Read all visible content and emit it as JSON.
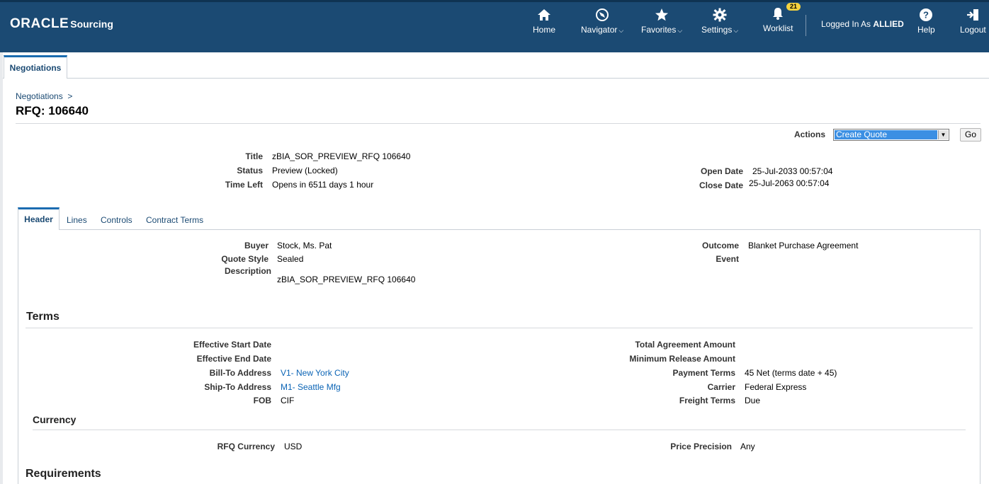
{
  "header": {
    "logo": "ORACLE",
    "product": "Sourcing",
    "nav": {
      "home": "Home",
      "navigator": "Navigator",
      "favorites": "Favorites",
      "settings": "Settings",
      "worklist": "Worklist",
      "worklist_count": "21",
      "help": "Help",
      "logout": "Logout"
    },
    "logged_in_prefix": "Logged In As",
    "logged_in_user": "ALLIED",
    "caret": "⌵"
  },
  "main_tab": "Negotiations",
  "breadcrumb": {
    "link": "Negotiations",
    "sep": ">"
  },
  "page_title": "RFQ: 106640",
  "actions": {
    "label": "Actions",
    "selected": "Create Quote",
    "go": "Go"
  },
  "summary": {
    "title_label": "Title",
    "title_value": "zBIA_SOR_PREVIEW_RFQ 106640",
    "status_label": "Status",
    "status_value": "Preview (Locked)",
    "time_left_label": "Time Left",
    "time_left_value": "Opens in 6511 days 1 hour",
    "open_date_label": "Open Date",
    "open_date_value": "25-Jul-2033 00:57:04",
    "close_date_label": "Close Date",
    "close_date_value": "25-Jul-2063 00:57:04"
  },
  "sub_tabs": [
    "Header",
    "Lines",
    "Controls",
    "Contract Terms"
  ],
  "header_tab": {
    "buyer_label": "Buyer",
    "buyer_value": "Stock, Ms. Pat",
    "quote_style_label": "Quote Style",
    "quote_style_value": "Sealed",
    "description_label": "Description",
    "description_value": "zBIA_SOR_PREVIEW_RFQ 106640",
    "outcome_label": "Outcome",
    "outcome_value": "Blanket Purchase Agreement",
    "event_label": "Event"
  },
  "terms": {
    "heading": "Terms",
    "effective_start_label": "Effective Start Date",
    "effective_end_label": "Effective End Date",
    "bill_to_label": "Bill-To Address",
    "bill_to_value": "V1- New York City",
    "ship_to_label": "Ship-To Address",
    "ship_to_value": "M1- Seattle Mfg",
    "fob_label": "FOB",
    "fob_value": "CIF",
    "total_agreement_label": "Total Agreement Amount",
    "min_release_label": "Minimum Release Amount",
    "payment_terms_label": "Payment Terms",
    "payment_terms_value": "45 Net (terms date + 45)",
    "carrier_label": "Carrier",
    "carrier_value": "Federal Express",
    "freight_terms_label": "Freight Terms",
    "freight_terms_value": "Due"
  },
  "currency": {
    "heading": "Currency",
    "rfq_currency_label": "RFQ Currency",
    "rfq_currency_value": "USD",
    "price_precision_label": "Price Precision",
    "price_precision_value": "Any"
  },
  "requirements": {
    "heading": "Requirements"
  },
  "colors": {
    "header_bg": "#1b4a73",
    "link": "#0b64b5",
    "select_highlight": "#3b8fe3",
    "badge": "#f5d33f"
  }
}
